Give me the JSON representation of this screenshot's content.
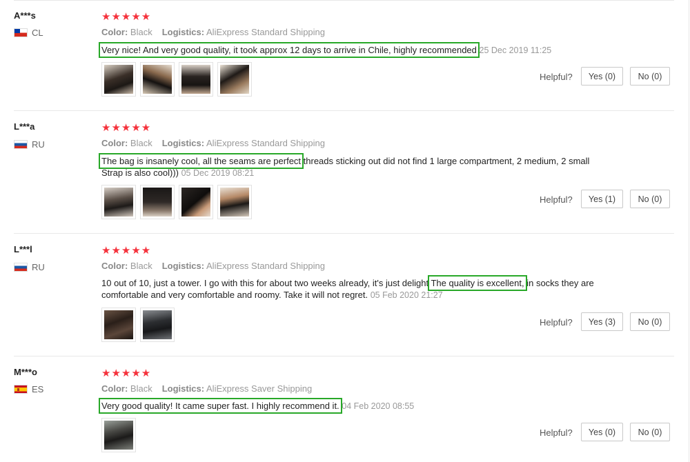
{
  "labels": {
    "color": "Color:",
    "logistics": "Logistics:",
    "helpful": "Helpful?"
  },
  "colors": {
    "star": "#f5323c",
    "highlight_box": "#28a828",
    "meta_text": "#999999"
  },
  "reviews": [
    {
      "user": "A***s",
      "country": "CL",
      "flag_icon": "chile-flag-icon",
      "rating": 5,
      "stars": "★★★★★",
      "color": "Black",
      "logistics": "AliExpress Standard Shipping",
      "text_highlight": "Very nice! And very good quality, it took approx 12 days to arrive in Chile, highly recommended",
      "date": "25 Dec 2019 11:25",
      "photos": 4,
      "yes": "Yes (0)",
      "no": "No (0)"
    },
    {
      "user": "L***a",
      "country": "RU",
      "flag_icon": "russia-flag-icon",
      "rating": 5,
      "stars": "★★★★★",
      "color": "Black",
      "logistics": "AliExpress Standard Shipping",
      "text_highlight": "The bag is insanely cool, all the seams are perfect",
      "text_rest": " threads sticking out did not find 1 large compartment, 2 medium, 2 small Strap is also cool)))",
      "date": "05 Dec 2019 08:21",
      "photos": 4,
      "yes": "Yes (1)",
      "no": "No (0)"
    },
    {
      "user": "L***l",
      "country": "RU",
      "flag_icon": "russia-flag-icon",
      "rating": 5,
      "stars": "★★★★★",
      "color": "Black",
      "logistics": "AliExpress Standard Shipping",
      "text_before": "10 out of 10, just a tower. I go with this for about two weeks already, it's just delight ",
      "text_highlight": "The quality is excellent,",
      "text_after": " in socks they are comfortable and very comfortable and roomy. Take it will not regret.",
      "date": "05 Feb 2020 21:27",
      "photos": 2,
      "yes": "Yes (3)",
      "no": "No (0)"
    },
    {
      "user": "M***o",
      "country": "ES",
      "flag_icon": "spain-flag-icon",
      "rating": 5,
      "stars": "★★★★★",
      "color": "Black",
      "logistics": "AliExpress Saver Shipping",
      "text_highlight": "Very good quality! It came super fast. I highly recommend it.",
      "date": "04 Feb 2020 08:55",
      "photos": 1,
      "yes": "Yes (0)",
      "no": "No (0)"
    }
  ]
}
